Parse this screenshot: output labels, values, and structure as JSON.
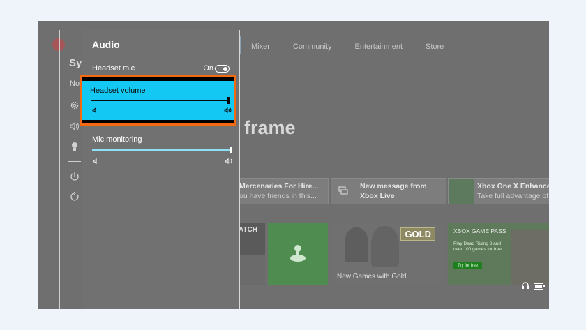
{
  "topnav": [
    "Mixer",
    "Community",
    "Entertainment",
    "Store"
  ],
  "hero_title": "frame",
  "cards": [
    {
      "title": "Mercenaries For Hire...",
      "subtitle": "ou have friends in this..."
    },
    {
      "title": "New message from",
      "subtitle": "Xbox Live"
    },
    {
      "title": "Xbox One X Enhance",
      "subtitle": "Take full advantage of"
    }
  ],
  "tiles": {
    "tile1_label": "ATCH",
    "gold_badge": "GOLD",
    "gold_caption": "New Games with Gold",
    "gamepass_header": "XBOX GAME PASS",
    "gamepass_sub": "Play Dead Rising 3 and over 100 games for free",
    "gamepass_button": "Try for free"
  },
  "rail": {
    "title_partial": "Sy",
    "sub_partial": "No"
  },
  "audio_panel": {
    "title": "Audio",
    "headset_mic_label": "Headset mic",
    "headset_mic_state": "On",
    "headset_volume_label": "Headset volume",
    "headset_volume_level": 1.0,
    "mic_monitoring_label": "Mic monitoring",
    "mic_monitoring_level": 1.0
  },
  "colors": {
    "highlight_border": "#f36a10",
    "highlight_fill": "#13c9f3",
    "slider_track": "#8fdff5"
  },
  "icons": [
    "settings-icon",
    "speaker-icon",
    "lightbulb-icon",
    "power-icon",
    "restart-icon",
    "headset-icon",
    "battery-icon",
    "message-icon"
  ]
}
